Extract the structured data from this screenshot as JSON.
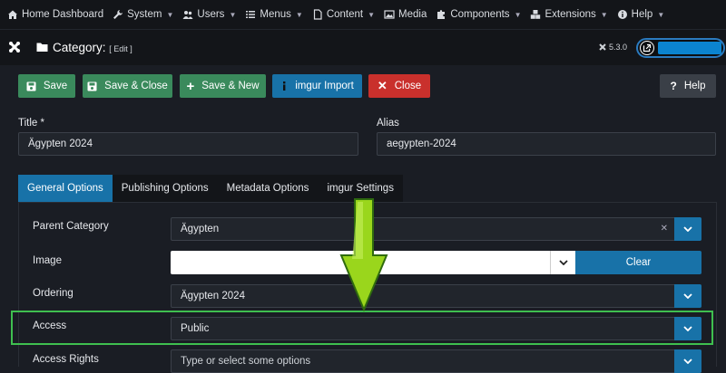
{
  "topnav": {
    "items": [
      {
        "label": "Home Dashboard",
        "icon": "home-icon",
        "caret": false
      },
      {
        "label": "System",
        "icon": "wrench-icon",
        "caret": true
      },
      {
        "label": "Users",
        "icon": "users-icon",
        "caret": true
      },
      {
        "label": "Menus",
        "icon": "list-icon",
        "caret": true
      },
      {
        "label": "Content",
        "icon": "file-icon",
        "caret": true
      },
      {
        "label": "Media",
        "icon": "image-icon",
        "caret": false
      },
      {
        "label": "Components",
        "icon": "puzzle-icon",
        "caret": true
      },
      {
        "label": "Extensions",
        "icon": "cubes-icon",
        "caret": true
      },
      {
        "label": "Help",
        "icon": "info-icon",
        "caret": true
      }
    ]
  },
  "header": {
    "title": "Category:",
    "mode": "[ Edit ]",
    "version": "5.3.0"
  },
  "toolbar": {
    "save": "Save",
    "save_close": "Save & Close",
    "save_new": "Save & New",
    "imgur_import": "imgur Import",
    "close": "Close",
    "help": "Help"
  },
  "form": {
    "title_label": "Title *",
    "title_value": "Ägypten 2024",
    "alias_label": "Alias",
    "alias_value": "aegypten-2024"
  },
  "tabs": [
    "General Options",
    "Publishing Options",
    "Metadata Options",
    "imgur Settings"
  ],
  "fields": {
    "parent_label": "Parent Category",
    "parent_value": "Ägypten",
    "image_label": "Image",
    "image_clear": "Clear",
    "ordering_label": "Ordering",
    "ordering_value": "Ägypten 2024",
    "access_label": "Access",
    "access_value": "Public",
    "rights_label": "Access Rights",
    "rights_placeholder": "Type or select some options"
  },
  "colors": {
    "accent": "#1872a8",
    "success": "#3a8a5c",
    "danger": "#c9302c",
    "highlight": "#3fbf4f",
    "arrow": "#9ad61c"
  }
}
